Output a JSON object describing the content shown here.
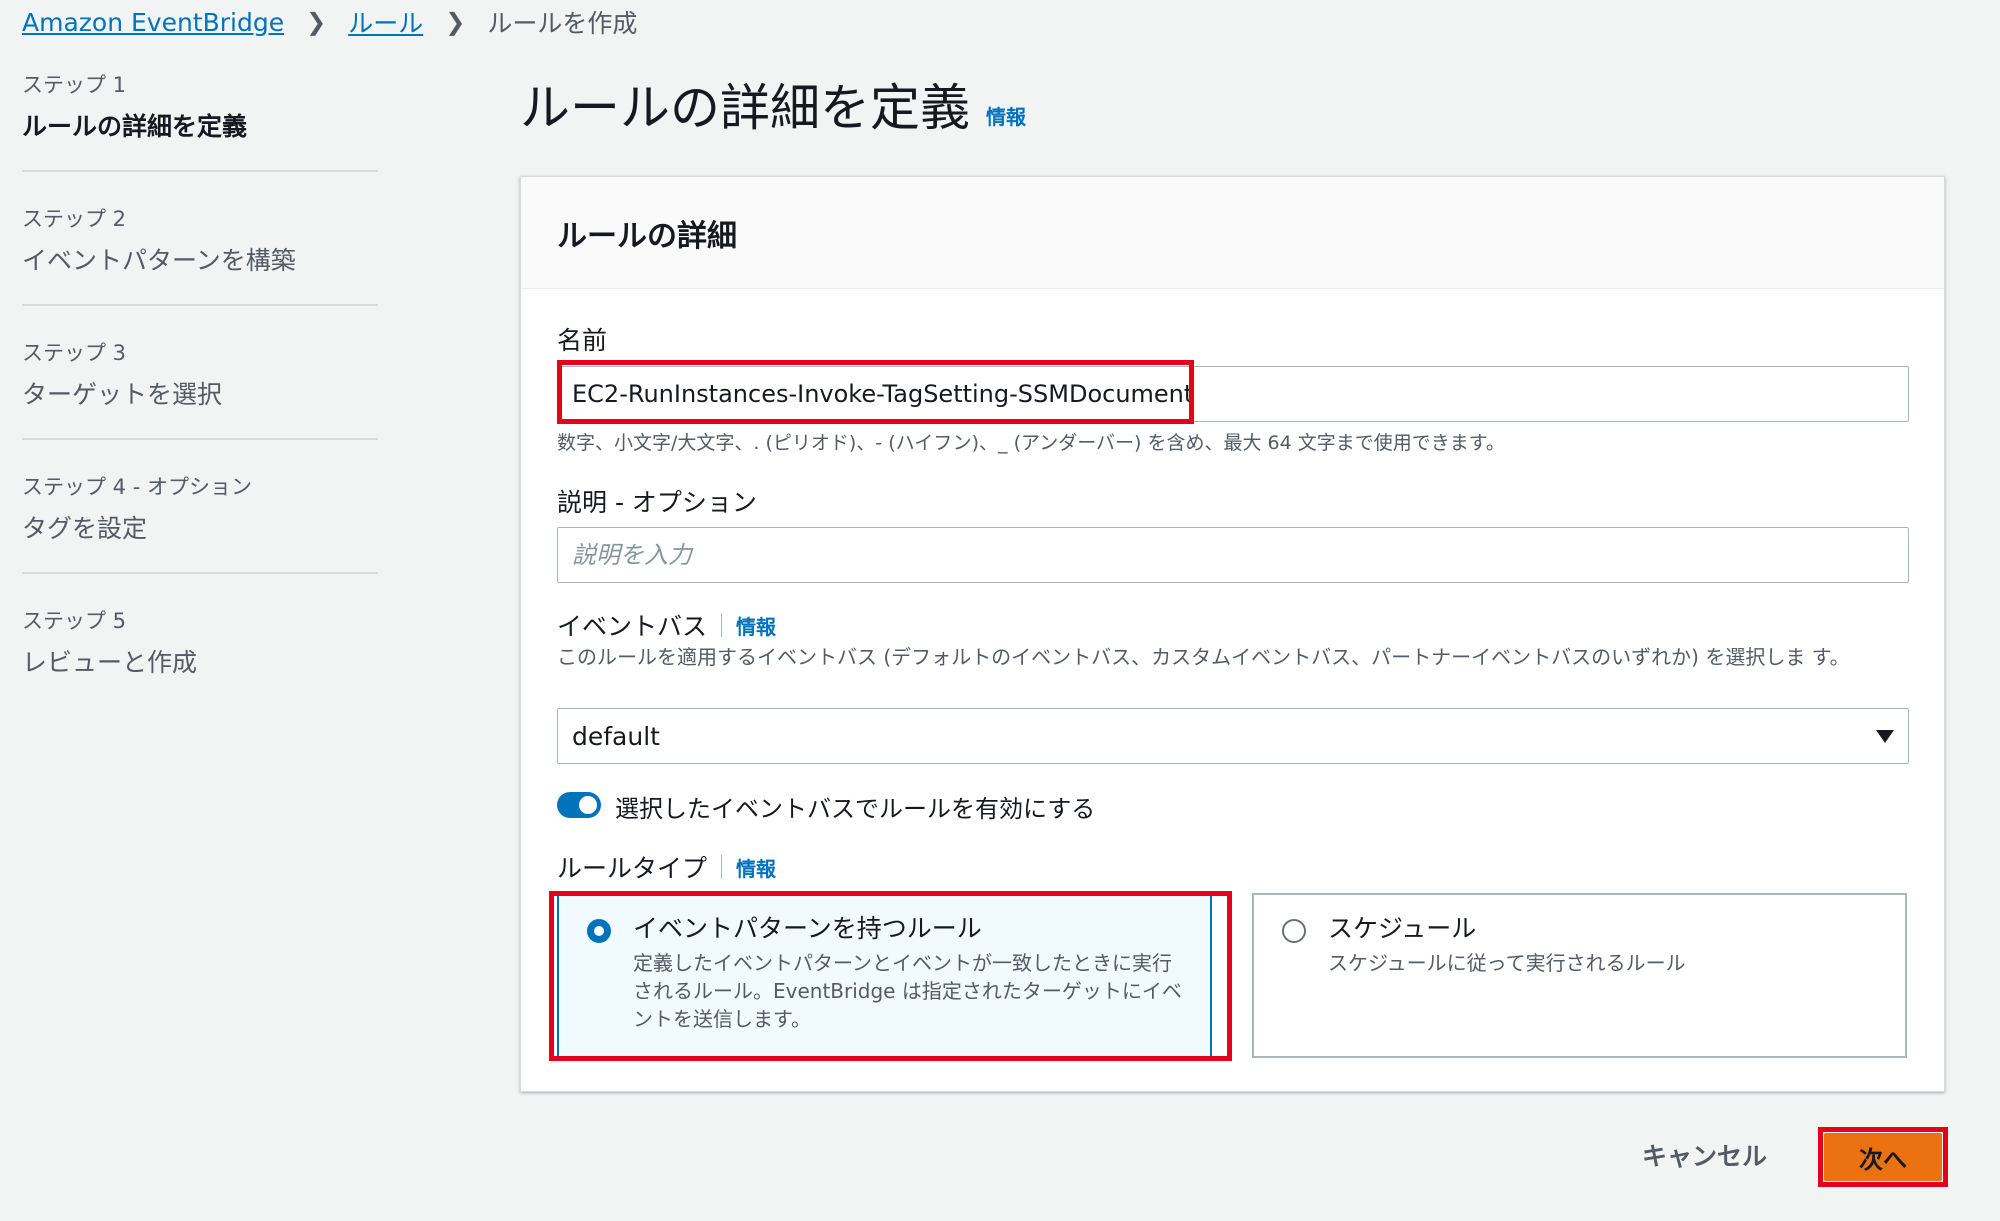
{
  "breadcrumb": {
    "items": [
      "Amazon EventBridge",
      "ルール",
      "ルールを作成"
    ]
  },
  "steps": [
    {
      "num": "ステップ 1",
      "title": "ルールの詳細を定義"
    },
    {
      "num": "ステップ 2",
      "title": "イベントパターンを構築"
    },
    {
      "num": "ステップ 3",
      "title": "ターゲットを選択"
    },
    {
      "num": "ステップ 4 - オプション",
      "title": "タグを設定"
    },
    {
      "num": "ステップ 5",
      "title": "レビューと作成"
    }
  ],
  "header": {
    "title": "ルールの詳細を定義",
    "info": "情報"
  },
  "panel": {
    "title": "ルールの詳細",
    "name": {
      "label": "名前",
      "value": "EC2-RunInstances-Invoke-TagSetting-SSMDocument",
      "hint": "数字、小文字/大文字、. (ピリオド)、- (ハイフン)、_ (アンダーバー) を含め、最大 64 文字まで使用できます。"
    },
    "description": {
      "label": "説明 - オプション",
      "placeholder": "説明を入力"
    },
    "event_bus": {
      "label": "イベントバス",
      "info": "情報",
      "desc": "このルールを適用するイベントバス (デフォルトのイベントバス、カスタムイベントバス、パートナーイベントバスのいずれか) を選択しま す。",
      "selected": "default"
    },
    "toggle": {
      "label": "選択したイベントバスでルールを有効にする",
      "enabled": true
    },
    "rule_type": {
      "label": "ルールタイプ",
      "info": "情報",
      "options": [
        {
          "title": "イベントパターンを持つルール",
          "desc": "定義したイベントパターンとイベントが一致したときに実行されるルール。EventBridge は指定されたターゲットにイベントを送信します。",
          "selected": true
        },
        {
          "title": "スケジュール",
          "desc": "スケジュールに従って実行されるルール",
          "selected": false
        }
      ]
    }
  },
  "footer": {
    "cancel": "キャンセル",
    "next": "次へ"
  },
  "colors": {
    "accent": "#0073bb",
    "primary_button": "#ec7211",
    "highlight": "#e5001c"
  }
}
